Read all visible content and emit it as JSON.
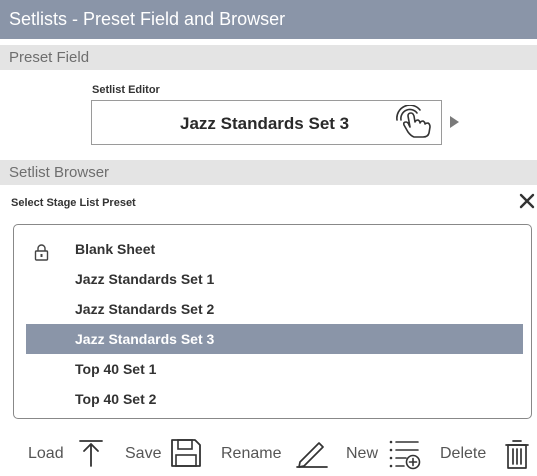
{
  "window": {
    "title": "Setlists - Preset Field and Browser"
  },
  "preset_field": {
    "header": "Preset Field",
    "editor_label": "Setlist Editor",
    "value": "Jazz Standards Set 3"
  },
  "browser": {
    "header": "Setlist Browser",
    "select_label": "Select Stage List Preset",
    "items": [
      {
        "label": "Blank Sheet",
        "locked": true,
        "selected": false
      },
      {
        "label": "Jazz Standards Set 1",
        "locked": false,
        "selected": false
      },
      {
        "label": "Jazz Standards Set 2",
        "locked": false,
        "selected": false
      },
      {
        "label": "Jazz Standards Set 3",
        "locked": false,
        "selected": true
      },
      {
        "label": "Top 40 Set 1",
        "locked": false,
        "selected": false
      },
      {
        "label": "Top 40 Set 2",
        "locked": false,
        "selected": false
      }
    ]
  },
  "toolbar": {
    "load_label": "Load",
    "save_label": "Save",
    "rename_label": "Rename",
    "new_label": "New",
    "delete_label": "Delete"
  },
  "colors": {
    "accent": "#8a95a8",
    "section_header_bg": "#e4e4e4",
    "section_header_text": "#6e6e6e"
  },
  "icons": {
    "touch": "touch-hand-icon",
    "close": "close-icon",
    "lock": "lock-icon",
    "load": "upload-arrow-icon",
    "save": "floppy-disk-icon",
    "rename": "pencil-icon",
    "new": "new-list-icon",
    "delete": "trash-icon"
  }
}
